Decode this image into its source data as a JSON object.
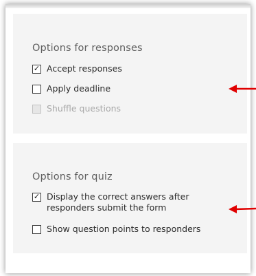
{
  "responses_section": {
    "title": "Options for responses",
    "options": [
      {
        "label": "Accept responses",
        "checked": true,
        "disabled": false
      },
      {
        "label": "Apply deadline",
        "checked": false,
        "disabled": false
      },
      {
        "label": "Shuffle questions",
        "checked": false,
        "disabled": true
      }
    ]
  },
  "quiz_section": {
    "title": "Options for quiz",
    "options": [
      {
        "label": "Display the correct answers after responders submit the form",
        "checked": true,
        "disabled": false
      },
      {
        "label": "Show question points to responders",
        "checked": false,
        "disabled": false
      }
    ]
  },
  "icons": {
    "check": "✓",
    "annotation_arrow": "red-left-arrow"
  },
  "colors": {
    "panel_bg": "#f4f4f4",
    "arrow": "#e00000",
    "disabled_text": "#a8a8a8"
  }
}
